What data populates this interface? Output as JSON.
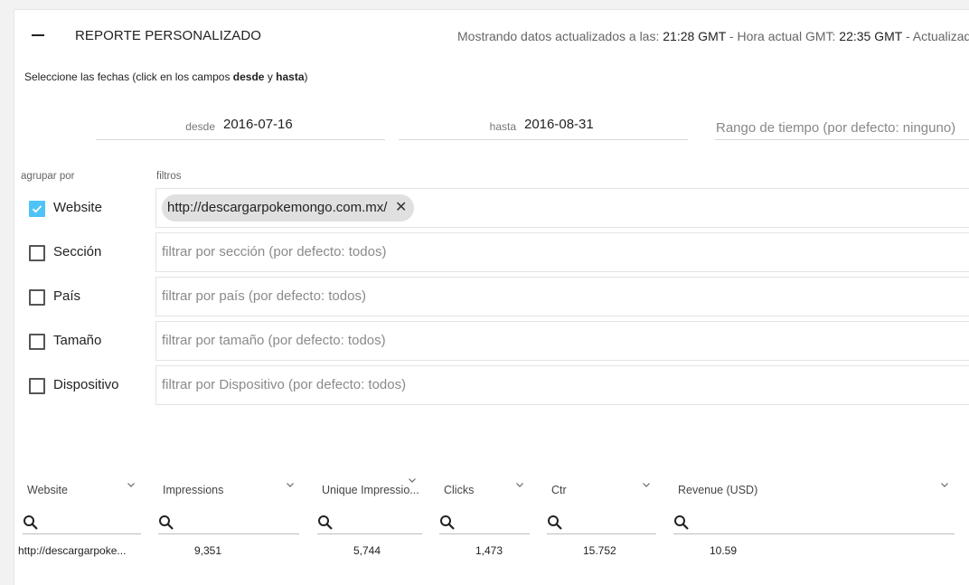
{
  "header": {
    "title": "REPORTE PERSONALIZADO",
    "status_prefix": "Mostrando datos actualizados a las:",
    "updated_time": "21:28 GMT",
    "current_prefix": "- Hora actual GMT:",
    "current_time": "22:35 GMT",
    "status_suffix": "- Actualizado"
  },
  "instructions": {
    "text_before": "Seleccione las fechas (click en los campos",
    "from_word": "desde",
    "and_word": "y",
    "to_word": "hasta",
    "text_after": ")"
  },
  "dates": {
    "from_label": "desde",
    "from_value": "2016-07-16",
    "to_label": "hasta",
    "to_value": "2016-08-31",
    "range_placeholder": "Rango de tiempo (por defecto: ninguno)"
  },
  "group_by_label": "agrupar por",
  "filters_label": "filtros",
  "rows": [
    {
      "label": "Website",
      "checked": true,
      "chip": "http://descargarpokemongo.com.mx/",
      "placeholder": ""
    },
    {
      "label": "Sección",
      "checked": false,
      "chip": "",
      "placeholder": "filtrar por sección (por defecto: todos)"
    },
    {
      "label": "País",
      "checked": false,
      "chip": "",
      "placeholder": "filtrar por país (por defecto: todos)"
    },
    {
      "label": "Tamaño",
      "checked": false,
      "chip": "",
      "placeholder": "filtrar por tamaño (por defecto: todos)"
    },
    {
      "label": "Dispositivo",
      "checked": false,
      "chip": "",
      "placeholder": "filtrar por Dispositivo (por defecto: todos)"
    }
  ],
  "table": {
    "columns": [
      "Website",
      "Impressions",
      "Unique Impressio...",
      "Clicks",
      "Ctr",
      "Revenue (USD)"
    ],
    "row": [
      "http://descargarpoke...",
      "9,351",
      "5,744",
      "1,473",
      "15.752",
      "10.59"
    ]
  },
  "colors": {
    "accent": "#4fc3f7",
    "chip_bg": "#e0e0e0",
    "page_bg": "#f2f2f2"
  },
  "icons": {
    "collapse": "minus-icon",
    "check": "checkmark-icon",
    "chip_remove": "close-icon",
    "column_menu": "chevron-down-icon",
    "search": "search-icon"
  }
}
